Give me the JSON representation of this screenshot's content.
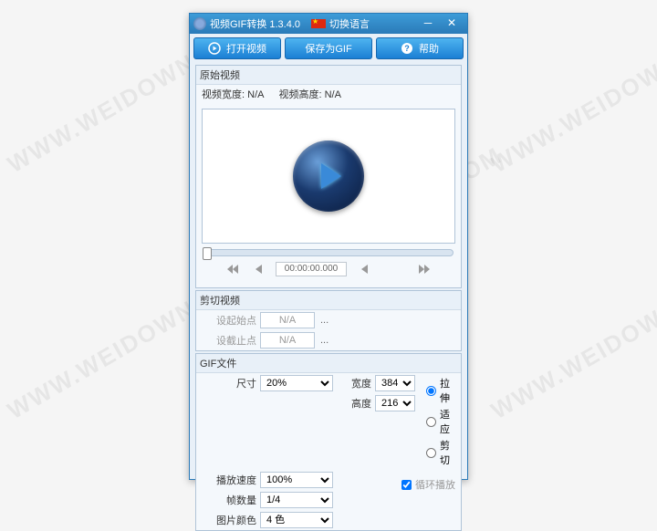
{
  "titlebar": {
    "title": "视频GIF转换 1.3.4.0",
    "lang_label": "切换语言"
  },
  "toolbar": {
    "open_video": "打开视频",
    "save_gif": "保存为GIF",
    "help": "帮助"
  },
  "panels": {
    "source": {
      "title": "原始视频",
      "width_label": "视频宽度:",
      "width_value": "N/A",
      "height_label": "视频高度:",
      "height_value": "N/A"
    },
    "clip": {
      "title": "剪切视频",
      "start_label": "设起始点",
      "start_value": "N/A",
      "end_label": "设截止点",
      "end_value": "N/A"
    },
    "gif": {
      "title": "GIF文件",
      "size_label": "尺寸",
      "size_value": "20%",
      "width_label": "宽度",
      "width_value": "384",
      "height_label": "高度",
      "height_value": "216",
      "speed_label": "播放速度",
      "speed_value": "100%",
      "frames_label": "帧数量",
      "frames_value": "1/4",
      "colors_label": "图片颜色",
      "colors_value": "4 色",
      "fit_stretch": "拉伸",
      "fit_fit": "适应",
      "fit_crop": "剪切",
      "loop_label": "循环播放"
    }
  },
  "player": {
    "timecode": "00:00:00.000"
  },
  "watermark": "WWW.WEIDOWN.COM"
}
